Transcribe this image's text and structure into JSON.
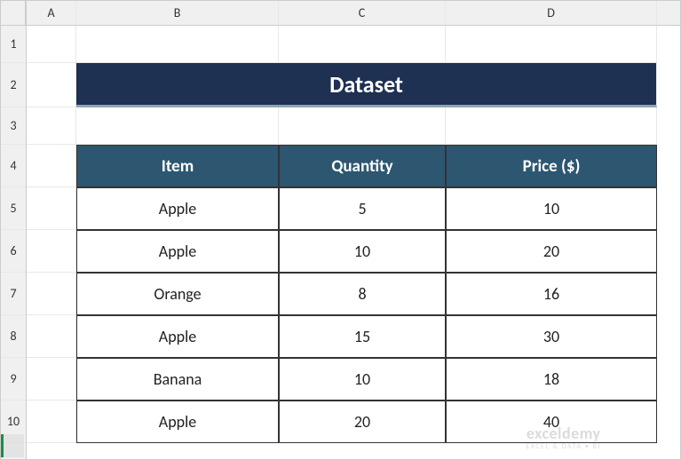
{
  "columns": [
    "A",
    "B",
    "C",
    "D"
  ],
  "rows": [
    "1",
    "2",
    "3",
    "4",
    "5",
    "6",
    "7",
    "8",
    "9",
    "10"
  ],
  "title": "Dataset",
  "table": {
    "headers": [
      "Item",
      "Quantity",
      "Price ($)"
    ],
    "data": [
      {
        "item": "Apple",
        "quantity": "5",
        "price": "10"
      },
      {
        "item": "Apple",
        "quantity": "10",
        "price": "20"
      },
      {
        "item": "Orange",
        "quantity": "8",
        "price": "16"
      },
      {
        "item": "Apple",
        "quantity": "15",
        "price": "30"
      },
      {
        "item": "Banana",
        "quantity": "10",
        "price": "18"
      },
      {
        "item": "Apple",
        "quantity": "20",
        "price": "40"
      }
    ]
  },
  "watermark": {
    "main": "exceldemy",
    "sub": "EXCEL & DATA • BI"
  }
}
